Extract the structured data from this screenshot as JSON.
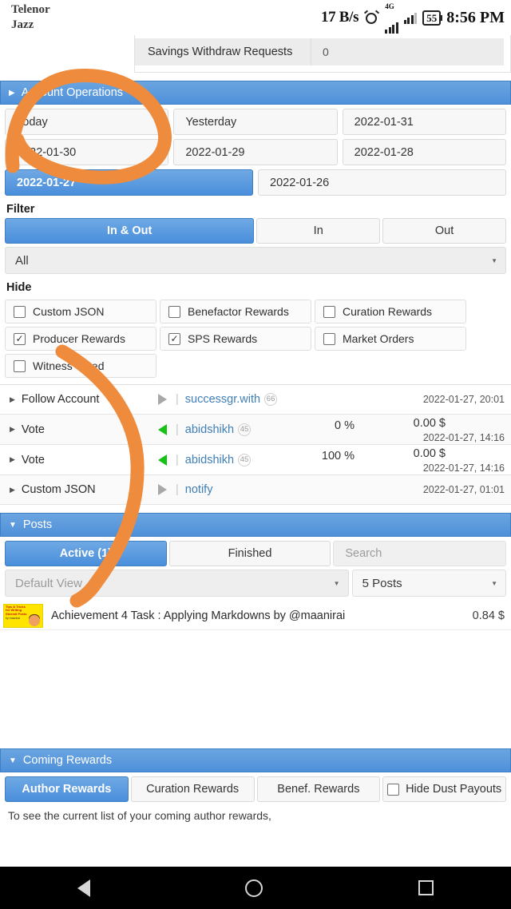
{
  "statusbar": {
    "carrier1": "Telenor",
    "carrier2": "Jazz",
    "net_speed": "17 B/s",
    "network_type": "4G",
    "battery": "55",
    "time": "8:56 PM",
    "alarm_icon": "alarm-clock-icon",
    "signal_icon": "signal-bars-icon"
  },
  "top_table": {
    "rows": [
      {
        "label": "Savings Withdraw Requests",
        "value": "0"
      }
    ]
  },
  "account_operations": {
    "title": "Account Operations",
    "collapse_icon": "triangle-right-icon",
    "date_buttons": [
      {
        "label": "Today",
        "selected": false
      },
      {
        "label": "Yesterday",
        "selected": false
      },
      {
        "label": "2022-01-31",
        "selected": false
      },
      {
        "label": "2022-01-30",
        "selected": false
      },
      {
        "label": "2022-01-29",
        "selected": false
      },
      {
        "label": "2022-01-28",
        "selected": false
      },
      {
        "label": "2022-01-27",
        "selected": true
      },
      {
        "label": "2022-01-26",
        "selected": false
      }
    ],
    "filter_label": "Filter",
    "filter_tabs": [
      {
        "label": "In & Out",
        "active": true
      },
      {
        "label": "In",
        "active": false
      },
      {
        "label": "Out",
        "active": false
      }
    ],
    "type_select": {
      "value": "All",
      "caret": "caret-down-icon"
    },
    "hide_label": "Hide",
    "hide_options": [
      {
        "label": "Custom JSON",
        "checked": false
      },
      {
        "label": "Benefactor Rewards",
        "checked": false
      },
      {
        "label": "Curation Rewards",
        "checked": false
      },
      {
        "label": "Producer Rewards",
        "checked": true
      },
      {
        "label": "SPS Rewards",
        "checked": true
      },
      {
        "label": "Market Orders",
        "checked": false
      },
      {
        "label": "Witness Voted",
        "checked": false
      }
    ],
    "operations": [
      {
        "type": "Follow Account",
        "direction": "out",
        "account": "successgr.with",
        "reputation": "66",
        "percent": "",
        "amount": "",
        "timestamp": "2022-01-27, 20:01"
      },
      {
        "type": "Vote",
        "direction": "in",
        "account": "abidshikh",
        "reputation": "45",
        "percent": "0 %",
        "amount": "0.00 $",
        "timestamp": "2022-01-27, 14:16"
      },
      {
        "type": "Vote",
        "direction": "in",
        "account": "abidshikh",
        "reputation": "45",
        "percent": "100 %",
        "amount": "0.00 $",
        "timestamp": "2022-01-27, 14:16"
      },
      {
        "type": "Custom JSON",
        "direction": "out",
        "account": "notify",
        "reputation": "",
        "percent": "",
        "amount": "",
        "timestamp": "2022-01-27, 01:01"
      }
    ]
  },
  "posts": {
    "title": "Posts",
    "collapse_icon": "triangle-down-icon",
    "tabs": [
      {
        "label": "Active (1)",
        "active": true
      },
      {
        "label": "Finished",
        "active": false
      }
    ],
    "search_placeholder": "Search",
    "view_select": {
      "value": "Default View",
      "caret": "caret-down-icon"
    },
    "count_select": {
      "value": "5 Posts",
      "caret": "caret-down-icon"
    },
    "items": [
      {
        "thumb_line1": "Tips & Tricks for Writing Steemit Posts",
        "thumb_line2": "by maanirai",
        "title": "Achievement 4 Task : Applying Markdowns by @maanirai",
        "amount": "0.84 $"
      }
    ]
  },
  "coming_rewards": {
    "title": "Coming Rewards",
    "collapse_icon": "triangle-down-icon",
    "tabs": [
      {
        "label": "Author Rewards",
        "active": true
      },
      {
        "label": "Curation Rewards",
        "active": false
      },
      {
        "label": "Benef. Rewards",
        "active": false
      }
    ],
    "hide_dust": {
      "label": "Hide Dust Payouts",
      "checked": false
    },
    "hint": "To see the current list of your coming author rewards,"
  },
  "navbar": {
    "back": "back-triangle-icon",
    "home": "home-circle-icon",
    "recents": "recents-square-icon"
  },
  "colors": {
    "accent_blue": "#4e90d9",
    "annotation_orange": "#ef8b3c",
    "incoming_green": "#17c217",
    "link_blue": "#3f7fb5"
  }
}
